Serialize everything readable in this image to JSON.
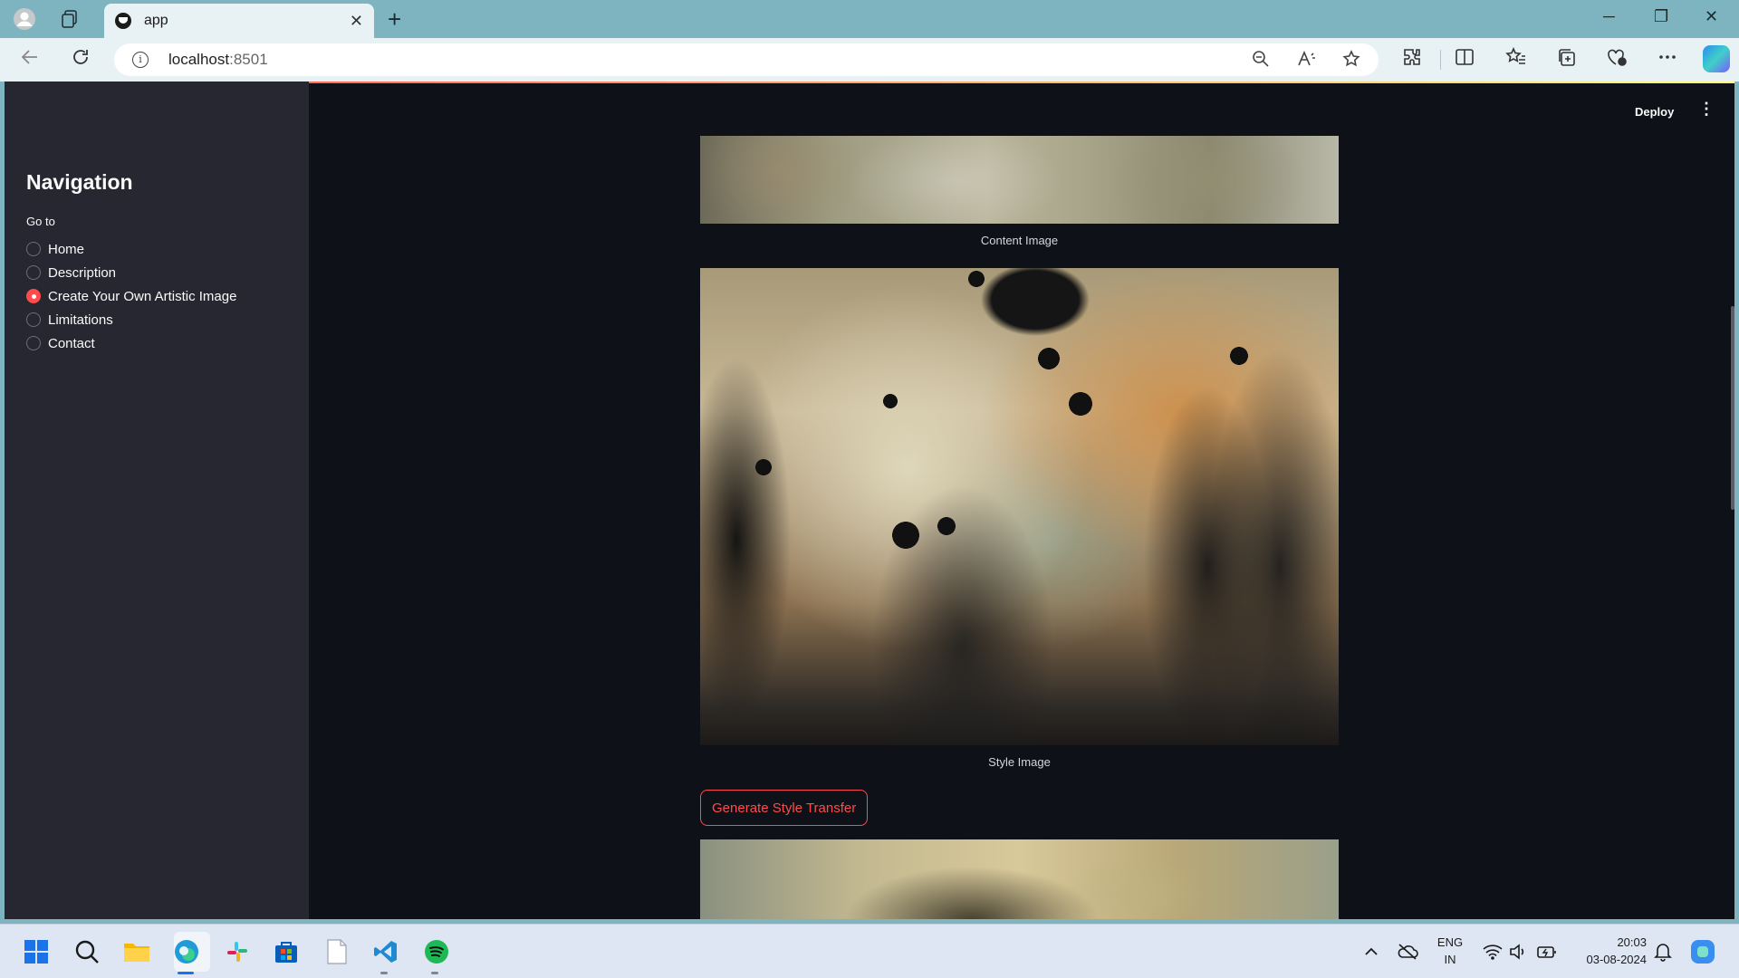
{
  "browser": {
    "tab_title": "app",
    "tab_close": "✕",
    "new_tab": "+",
    "url_host": "localhost",
    "url_port": ":8501",
    "window_controls": {
      "minimize": "─",
      "restore": "❐",
      "close": "✕"
    }
  },
  "app": {
    "deploy_label": "Deploy",
    "menu_icon": "⋮",
    "sidebar": {
      "title": "Navigation",
      "radio_label": "Go to",
      "options": [
        {
          "label": "Home",
          "selected": false
        },
        {
          "label": "Description",
          "selected": false
        },
        {
          "label": "Create Your Own Artistic Image",
          "selected": true
        },
        {
          "label": "Limitations",
          "selected": false
        },
        {
          "label": "Contact",
          "selected": false
        }
      ]
    },
    "main": {
      "content_caption": "Content Image",
      "style_caption": "Style Image",
      "generate_button": "Generate Style Transfer"
    }
  },
  "taskbar": {
    "language": "ENG",
    "region": "IN",
    "time": "20:03",
    "date": "03-08-2024"
  },
  "colors": {
    "accent": "#ff4b4b",
    "sidebar_bg": "#262730",
    "main_bg": "#0e1117"
  }
}
